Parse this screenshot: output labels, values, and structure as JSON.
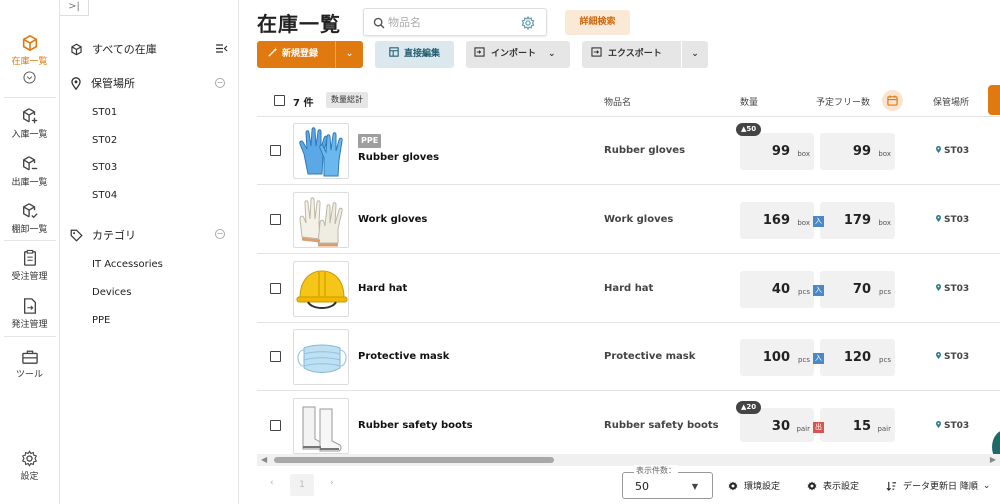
{
  "nav": {
    "items": [
      {
        "label": "在庫一覧",
        "active": true
      },
      {
        "label": "入庫一覧"
      },
      {
        "label": "出庫一覧"
      },
      {
        "label": "棚卸一覧"
      },
      {
        "label": "受注管理"
      },
      {
        "label": "発注管理"
      },
      {
        "label": "ツール"
      },
      {
        "label": "設定"
      }
    ]
  },
  "sidebar": {
    "collapse_glyph": ">|",
    "all_label": "すべての在庫",
    "locations_label": "保管場所",
    "locations": [
      "ST01",
      "ST02",
      "ST03",
      "ST04"
    ],
    "categories_label": "カテゴリ",
    "categories": [
      "IT Accessories",
      "Devices",
      "PPE"
    ]
  },
  "header": {
    "title": "在庫一覧",
    "search_placeholder": "物品名",
    "advanced_search": "詳細検索"
  },
  "toolbar": {
    "new_label": "新規登録",
    "direct_edit_label": "直接編集",
    "import_label": "インポート",
    "export_label": "エクスポート"
  },
  "table": {
    "count_label": "7 件",
    "sum_label": "数量総計",
    "columns": {
      "name": "物品名",
      "qty": "数量",
      "free": "予定フリー数",
      "location": "保管場所"
    },
    "rows": [
      {
        "tag": "PPE",
        "name": "Rubber gloves",
        "qty": "99",
        "qty_unit": "box",
        "free": "99",
        "free_unit": "box",
        "badge": "50",
        "mark": "",
        "location": "ST03"
      },
      {
        "tag": "",
        "name": "Work gloves",
        "qty": "169",
        "qty_unit": "box",
        "free": "179",
        "free_unit": "box",
        "badge": "",
        "mark": "入",
        "location": "ST03"
      },
      {
        "tag": "",
        "name": "Hard hat",
        "qty": "40",
        "qty_unit": "pcs",
        "free": "70",
        "free_unit": "pcs",
        "badge": "",
        "mark": "入",
        "location": "ST03"
      },
      {
        "tag": "",
        "name": "Protective mask",
        "qty": "100",
        "qty_unit": "pcs",
        "free": "120",
        "free_unit": "pcs",
        "badge": "",
        "mark": "入",
        "location": "ST03"
      },
      {
        "tag": "",
        "name": "Rubber safety boots",
        "qty": "30",
        "qty_unit": "pair",
        "free": "15",
        "free_unit": "pair",
        "badge": "20",
        "mark": "出",
        "location": "ST03"
      }
    ]
  },
  "footer": {
    "page": "1",
    "page_size_legend": "表示件数：",
    "page_size": "50",
    "env_settings": "環境設定",
    "display_settings": "表示設定",
    "sort_label": "データ更新日 降順"
  },
  "colors": {
    "accent": "#e07a10",
    "in_mark": "#4a89c8",
    "out_mark": "#d9534f"
  }
}
